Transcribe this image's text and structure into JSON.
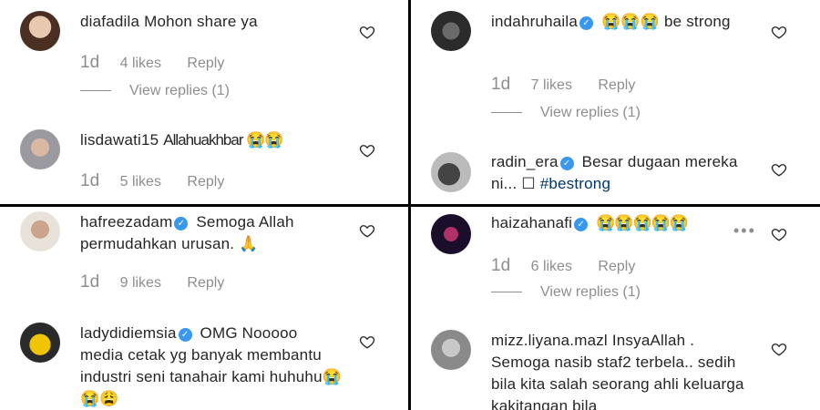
{
  "panels": [
    {
      "comments": [
        {
          "username": "diafadila",
          "verified": false,
          "text": "Mohon share ya",
          "age": "1d",
          "likes": "4 likes",
          "reply": "Reply",
          "view_replies": "View replies (1)"
        },
        {
          "username": "lisdawati15",
          "verified": false,
          "text": "Allahuakhbar 😭😭",
          "age": "1d",
          "likes": "5 likes",
          "reply": "Reply"
        }
      ]
    },
    {
      "comments": [
        {
          "username": "indahruhaila",
          "verified": true,
          "text": "😭😭😭 be strong",
          "age": "1d",
          "likes": "7 likes",
          "reply": "Reply",
          "view_replies": "View replies (1)"
        },
        {
          "username": "radin_era",
          "verified": true,
          "text": "Besar dugaan mereka ni... ☐",
          "hashtag": "#bestrong"
        }
      ]
    },
    {
      "comments": [
        {
          "username": "hafreezadam",
          "verified": true,
          "text": "Semoga Allah permudahkan urusan. 🙏",
          "age": "1d",
          "likes": "9 likes",
          "reply": "Reply"
        },
        {
          "username": "ladydidiemsia",
          "verified": true,
          "text": "OMG Nooooo media cetak yg banyak membantu industri seni tanahair kami huhuhu😭😭😩"
        }
      ]
    },
    {
      "comments": [
        {
          "username": "haizahanafi",
          "verified": true,
          "text": "😭😭😭😭😭",
          "age": "1d",
          "likes": "6 likes",
          "reply": "Reply",
          "view_replies": "View replies (1)",
          "more": "•••"
        },
        {
          "username": "mizz.liyana.mazl",
          "verified": false,
          "text": "InsyaAllah . Semoga nasib staf2 terbela.. sedih bila kita salah seorang ahli keluarga kakitangan bila"
        }
      ]
    }
  ],
  "icons": {
    "like": "heart-outline-icon",
    "verified": "verified-badge-icon",
    "more": "more-options-icon"
  },
  "colors": {
    "text": "#262626",
    "muted": "#8e8e8e",
    "verified": "#3897f0",
    "hashtag": "#00376b",
    "divider": "#000000"
  }
}
